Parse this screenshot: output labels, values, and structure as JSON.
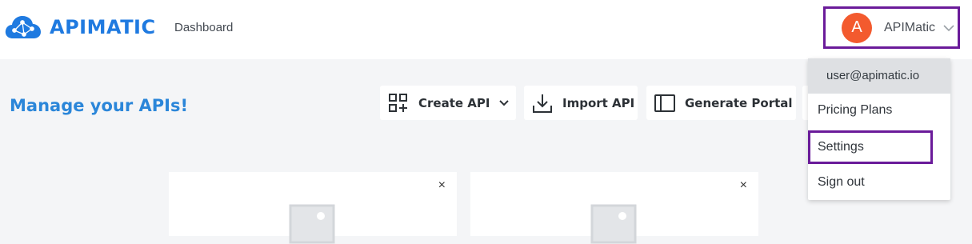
{
  "brand": {
    "name": "APIMATIC",
    "color": "#1f7ae0"
  },
  "nav": {
    "dashboard": "Dashboard"
  },
  "user": {
    "avatar_letter": "A",
    "name": "APIMatic",
    "avatar_color": "#f35a2e"
  },
  "main": {
    "title": "Manage your APIs!"
  },
  "toolbar": {
    "create_label": "Create API",
    "import_label": "Import API",
    "portal_label": "Generate Portal"
  },
  "cards": [
    {
      "close": "×"
    },
    {
      "close": "×"
    }
  ],
  "dropdown": {
    "email": "user@apimatic.io",
    "items": [
      "Pricing Plans",
      "Settings",
      "Sign out"
    ]
  },
  "highlight_color": "#6a1b9a"
}
